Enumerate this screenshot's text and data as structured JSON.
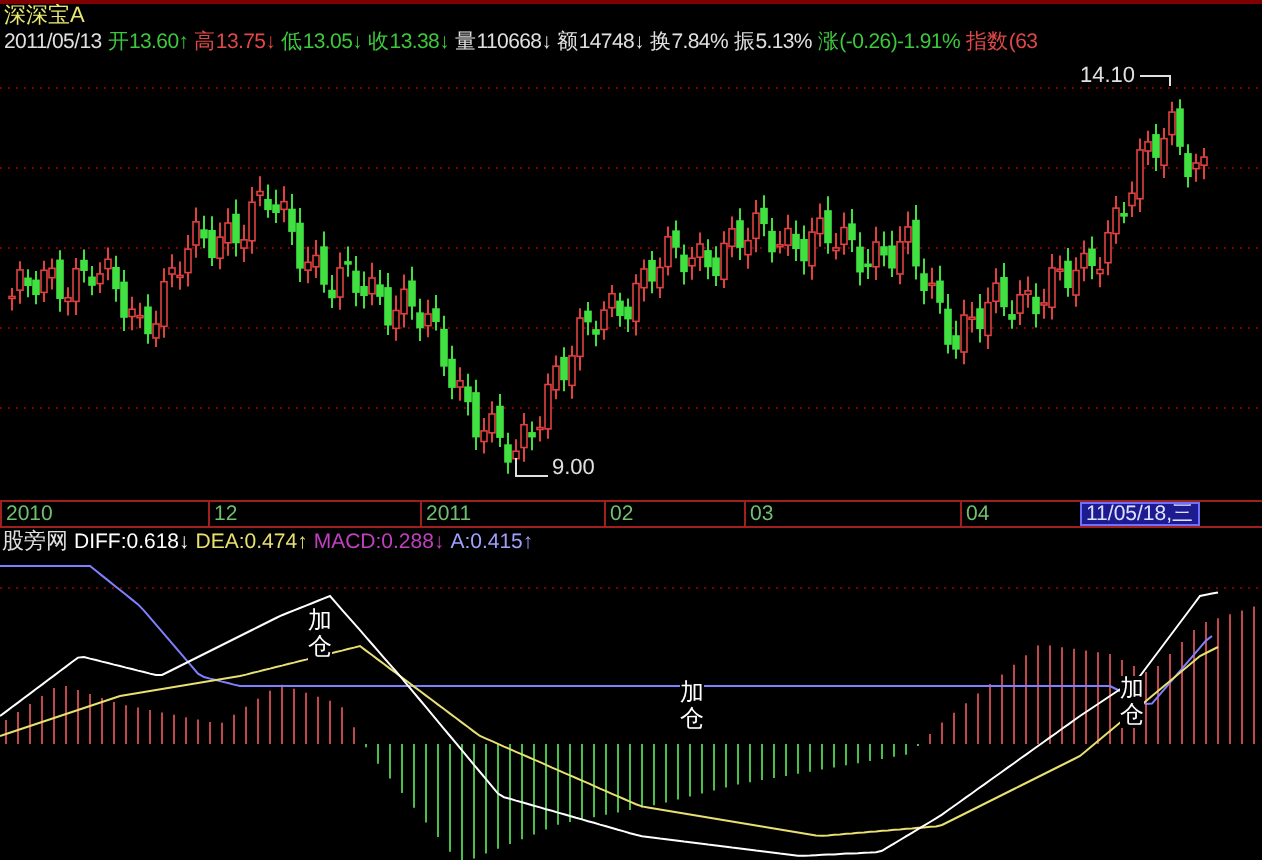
{
  "security": {
    "name": "深深宝A"
  },
  "quote": [
    {
      "text": "2011/05/13",
      "color": "#e0e0e0"
    },
    {
      "text": "开13.60",
      "arrow": "↑",
      "color": "#3cc83c"
    },
    {
      "text": "高13.75",
      "arrow": "↓",
      "color": "#e04848"
    },
    {
      "text": "低13.05",
      "arrow": "↓",
      "color": "#3cc83c"
    },
    {
      "text": "收13.38",
      "arrow": "↓",
      "color": "#3cc83c"
    },
    {
      "text": "量110668",
      "arrow": "↓",
      "color": "#e0e0e0"
    },
    {
      "text": "额14748",
      "arrow": "↓",
      "color": "#e0e0e0"
    },
    {
      "text": "换7.84%",
      "color": "#e0e0e0"
    },
    {
      "text": "振5.13%",
      "color": "#e0e0e0"
    },
    {
      "text": "涨(-0.26)-1.91%",
      "color": "#3cc83c"
    },
    {
      "text": "指数(63",
      "color": "#e04848"
    }
  ],
  "price_chart": {
    "high_label": "14.10",
    "low_label": "9.00"
  },
  "time_axis": {
    "ticks": [
      {
        "label": "2010"
      },
      {
        "label": "12"
      },
      {
        "label": "2011"
      },
      {
        "label": "02"
      },
      {
        "label": "03"
      },
      {
        "label": "04"
      }
    ],
    "cursor_date": "11/05/18,三"
  },
  "indicator": {
    "name": "股旁网",
    "values": [
      {
        "text": "DIFF:0.618",
        "arrow": "↓",
        "color": "#ffffff"
      },
      {
        "text": "DEA:0.474",
        "arrow": "↑",
        "color": "#e8e070"
      },
      {
        "text": "MACD:0.288",
        "arrow": "↓",
        "color": "#c040c0"
      },
      {
        "text": "A:0.415",
        "arrow": "↑",
        "color": "#a0a0ff"
      }
    ]
  },
  "macd_chart": {
    "markers": [
      "加仓",
      "加仓",
      "加仓"
    ]
  }
}
